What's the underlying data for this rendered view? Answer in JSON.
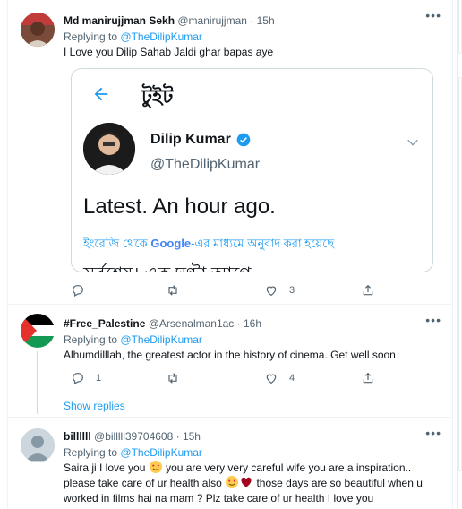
{
  "tweets": [
    {
      "name": "Md manirujjman Sekh",
      "handle": "@manirujjman",
      "dot": "·",
      "time": "15h",
      "replying_prefix": "Replying to",
      "replying_to": "@TheDilipKumar",
      "text": "I Love you Dilip Sahab Jaldi ghar bapas aye",
      "embed": {
        "header": "টুইট",
        "name": "Dilip Kumar",
        "handle": "@TheDilipKumar",
        "text": "Latest. An hour ago.",
        "translation_prefix": "ইংরেজি থেকে ",
        "translation_brand": "Google",
        "translation_suffix": "-এর মাধ্যমে অনুবাদ করা হয়েছে",
        "cut_text": "সর্বশেষ। এক ঘণ্টা আগে"
      },
      "replies": "",
      "retweets": "",
      "likes": "3"
    },
    {
      "name": "#Free_Palestine",
      "handle": "@Arsenalman1ac",
      "dot": "·",
      "time": "16h",
      "replying_prefix": "Replying to",
      "replying_to": "@TheDilipKumar",
      "text": "Alhumdilllah, the greatest actor in the history of cinema. Get well soon",
      "replies": "1",
      "retweets": "",
      "likes": "4",
      "show_replies": "Show replies"
    },
    {
      "name": "billllll",
      "handle": "@billlll39704608",
      "dot": "·",
      "time": "15h",
      "replying_prefix": "Replying to",
      "replying_to": "@TheDilipKumar",
      "text_part1": "Saira ji I love you",
      "text_part2": " you are very very careful wife you are a inspiration..",
      "text_line2_part1": "please take care of ur health also",
      "text_line2_part2": "  those days are so beautiful when u",
      "text_line3": "worked  in films  hai na mam ?  Plz take care of ur health I love you"
    }
  ],
  "colors": {
    "accent": "#1d9bf0",
    "muted": "#536471",
    "border": "#eff3f4"
  },
  "icons": [
    "more-icon",
    "back-arrow-icon",
    "verified-icon",
    "chevron-down-icon",
    "reply-icon",
    "retweet-icon",
    "like-icon",
    "share-icon"
  ]
}
